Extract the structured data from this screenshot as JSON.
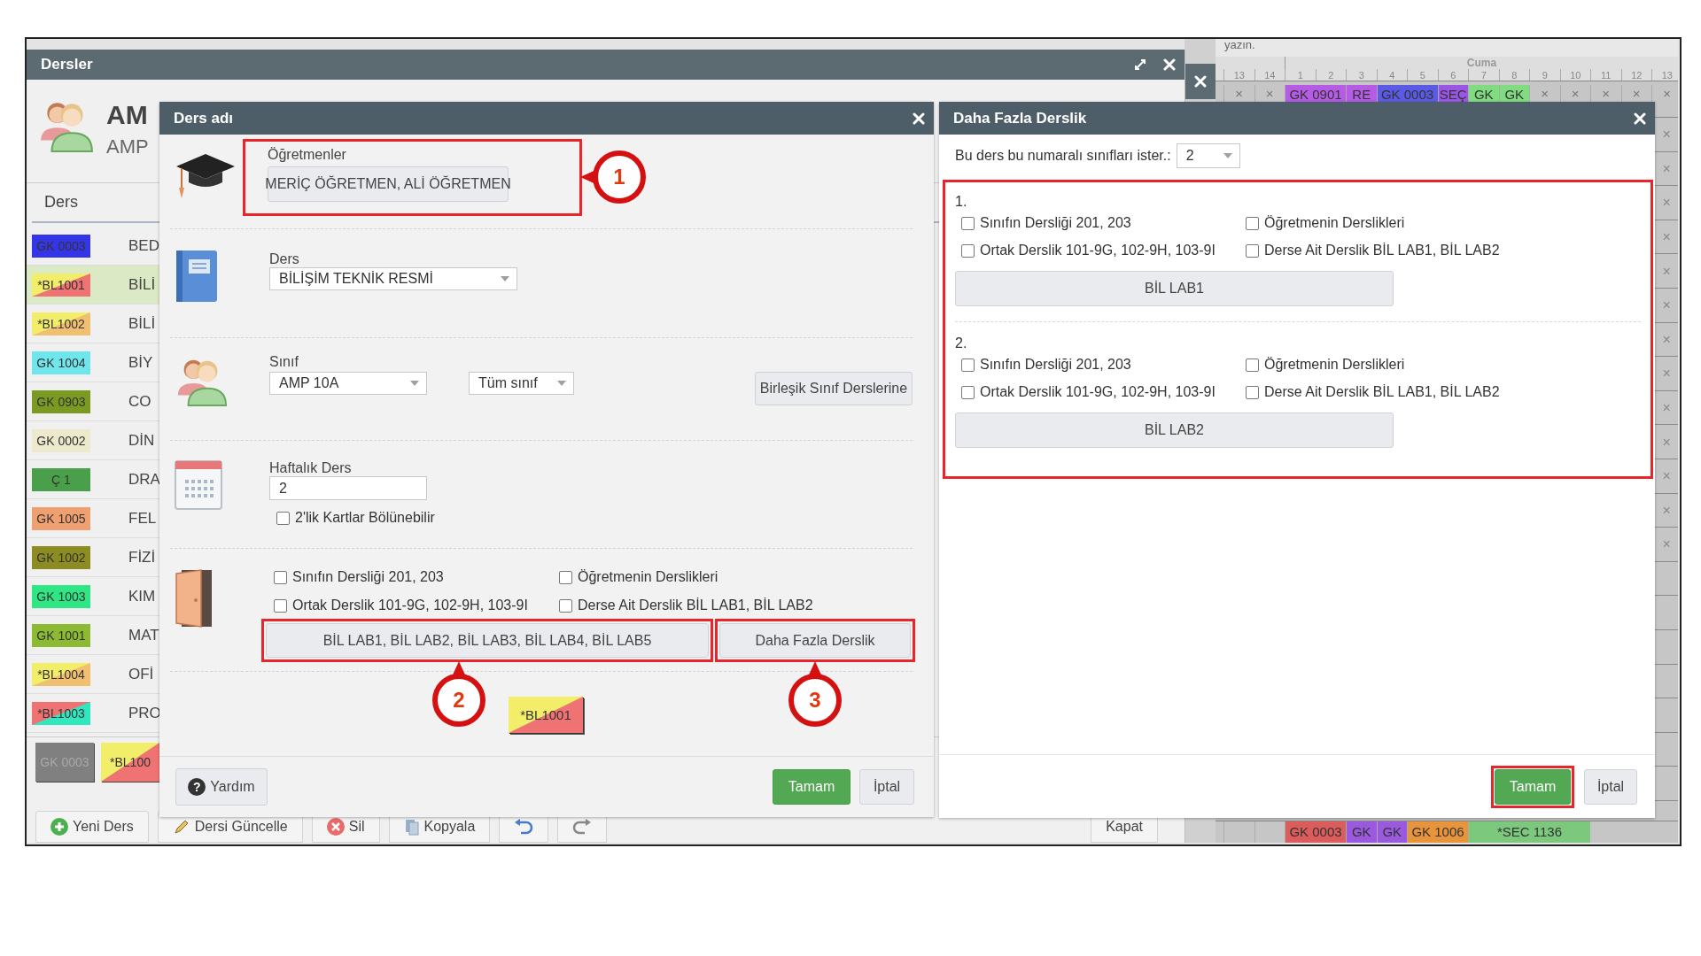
{
  "background_window": {
    "title": "Dersler",
    "class_title": "AM",
    "class_subtitle": "AMP",
    "list_header": "Ders",
    "lessons": [
      {
        "code": "GK 0003",
        "name": "BED",
        "color": "#3535e8",
        "selected": false
      },
      {
        "code": "*BL1001",
        "name": "BİLİ",
        "color": "#f2ee6a",
        "corner": {
          "color": "#f07373"
        },
        "selected": true
      },
      {
        "code": "*BL1002",
        "name": "BİLİ",
        "color": "#f2ee6a",
        "corner": {
          "color": "#f0c070"
        },
        "selected": false
      },
      {
        "code": "GK 1004",
        "name": "BİY",
        "color": "#6fe6ec",
        "selected": false
      },
      {
        "code": "GK 0903",
        "name": "CO",
        "color": "#7a9a22",
        "selected": false
      },
      {
        "code": "GK 0002",
        "name": "DİN",
        "color": "#ece9cc",
        "selected": false
      },
      {
        "code": "Ç 1",
        "name": "DRA",
        "color": "#4aa04a",
        "selected": false
      },
      {
        "code": "GK 1005",
        "name": "FEL",
        "color": "#f0a070",
        "selected": false
      },
      {
        "code": "GK 1002",
        "name": "FİZİ",
        "color": "#8c8c22",
        "selected": false
      },
      {
        "code": "GK 1003",
        "name": "KIM",
        "color": "#2ee684",
        "selected": false
      },
      {
        "code": "GK 1001",
        "name": "MAT",
        "color": "#8cbb33",
        "selected": false
      },
      {
        "code": "*BL1004",
        "name": "OFİ",
        "color": "#f2ee6a",
        "corner": {
          "color": "#f0c070"
        },
        "selected": false
      },
      {
        "code": "*BL1003",
        "name": "PRO",
        "color": "#f07373",
        "corner": {
          "color": "#30e8c0"
        },
        "selected": false
      }
    ],
    "tiles": [
      {
        "code": "GK 0003",
        "color": "#808080"
      },
      {
        "code": "*BL100",
        "color": "#f2ee6a",
        "corner": {
          "color": "#f07373"
        }
      }
    ],
    "toolbar": [
      {
        "kind": "add",
        "label": "Yeni Ders"
      },
      {
        "kind": "edit",
        "label": "Dersi Güncelle"
      },
      {
        "kind": "delete",
        "label": "Sil"
      },
      {
        "kind": "copy",
        "label": "Kopyala"
      },
      {
        "kind": "undo"
      },
      {
        "kind": "redo"
      }
    ],
    "close_button": "Kapat"
  },
  "schedule": {
    "note": "yazın.",
    "day": "Cuma",
    "previous_periods": [
      "13",
      "14"
    ],
    "day_periods": [
      "1",
      "2",
      "3",
      "4",
      "5",
      "6",
      "7",
      "8",
      "9",
      "10",
      "11",
      "12",
      "13"
    ],
    "top_row": [
      {
        "kind": "empty",
        "text": "×"
      },
      {
        "kind": "empty",
        "text": "×"
      },
      {
        "kind": "lesson-wide",
        "text": "GK 0901",
        "color": "#b65be6"
      },
      {
        "kind": "lesson",
        "text": "RE",
        "color": "#b65be6"
      },
      {
        "kind": "lesson-wide",
        "text": "GK 0003",
        "color": "#5a5ae6"
      },
      {
        "kind": "lesson",
        "text": "SEÇ",
        "color": "#9a55e6"
      },
      {
        "kind": "lesson",
        "text": "GK",
        "color": "#7fdc7f"
      },
      {
        "kind": "lesson",
        "text": "GK",
        "color": "#7fdc7f"
      },
      {
        "kind": "empty",
        "text": "×"
      },
      {
        "kind": "empty",
        "text": "×"
      },
      {
        "kind": "empty",
        "text": "×"
      },
      {
        "kind": "empty",
        "text": "×"
      },
      {
        "kind": "empty",
        "text": "×"
      }
    ],
    "side_marks": [
      "×",
      "×",
      "×",
      "×",
      "×",
      "×",
      "×",
      "×",
      "×",
      "×",
      "×",
      "×",
      "×"
    ],
    "bottom_row": [
      {
        "kind": "empty"
      },
      {
        "kind": "empty"
      },
      {
        "kind": "lesson-wide",
        "text": "GK 0003",
        "color": "#dc5c5c"
      },
      {
        "kind": "lesson",
        "text": "GK",
        "color": "#9b59e0"
      },
      {
        "kind": "lesson",
        "text": "GK",
        "color": "#9b59e0"
      },
      {
        "kind": "lesson-wide",
        "text": "GK 1006",
        "color": "#e8943a"
      },
      {
        "kind": "lesson-long",
        "text": "*SEC 1136",
        "color": "#7cc87c"
      }
    ]
  },
  "lesson_dialog": {
    "title": "Ders adı",
    "teachers_label": "Öğretmenler",
    "teachers_value": "MERİÇ ÖĞRETMEN, ALİ ÖĞRETMEN",
    "teachers_highlighted": true,
    "lesson_label": "Ders",
    "lesson_value": "BİLİŞİM TEKNİK RESMİ",
    "class_label": "Sınıf",
    "class_value": "AMP 10A",
    "group_value": "Tüm sınıf",
    "joint_button": "Birleşik Sınıf Derslerine",
    "weekly_label": "Haftalık Ders",
    "weekly_value": "2",
    "split_option": {
      "label": "2'lik Kartlar Bölünebilir",
      "checked": false
    },
    "room_options": [
      {
        "label": "Sınıfın Dersliği 201, 203",
        "checked": false
      },
      {
        "label": "Öğretmenin Derslikleri",
        "checked": false
      },
      {
        "label": "Ortak Derslik 101-9G, 102-9H, 103-9I",
        "checked": false
      },
      {
        "label": "Derse Ait Derslik BİL LAB1, BİL LAB2",
        "checked": false
      }
    ],
    "rooms_button": "BİL LAB1, BİL LAB2, BİL LAB3, BİL LAB4, BİL LAB5",
    "rooms_highlighted": true,
    "more_rooms_button": "Daha Fazla Derslik",
    "more_rooms_highlighted": true,
    "lesson_badge": {
      "code": "*BL1001",
      "color": "#f2ee6a",
      "corner": {
        "color": "#f07373"
      }
    },
    "help_icon": "?",
    "help_button": "Yardım",
    "ok_button": "Tamam",
    "cancel_button": "İptal"
  },
  "rooms_dialog": {
    "title": "Daha Fazla Derslik",
    "count_label": "Bu ders bu numaralı sınıfları ister.:",
    "count_value": "2",
    "groups_highlighted": true,
    "groups": [
      {
        "number": "1.",
        "options": [
          {
            "label": "Sınıfın Dersliği 201, 203",
            "checked": false
          },
          {
            "label": "Öğretmenin Derslikleri",
            "checked": false
          },
          {
            "label": "Ortak Derslik 101-9G, 102-9H, 103-9I",
            "checked": false
          },
          {
            "label": "Derse Ait Derslik BİL LAB1, BİL LAB2",
            "checked": false
          }
        ],
        "room_button": "BİL LAB1"
      },
      {
        "number": "2.",
        "options": [
          {
            "label": "Sınıfın Dersliği 201, 203",
            "checked": false
          },
          {
            "label": "Öğretmenin Derslikleri",
            "checked": false
          },
          {
            "label": "Ortak Derslik 101-9G, 102-9H, 103-9I",
            "checked": false
          },
          {
            "label": "Derse Ait Derslik BİL LAB1, BİL LAB2",
            "checked": false
          }
        ],
        "room_button": "BİL LAB2"
      }
    ],
    "ok_button": "Tamam",
    "ok_highlighted": true,
    "cancel_button": "İptal"
  },
  "annotations": {
    "callouts": [
      {
        "label": "1"
      },
      {
        "label": "2"
      },
      {
        "label": "3"
      }
    ]
  }
}
